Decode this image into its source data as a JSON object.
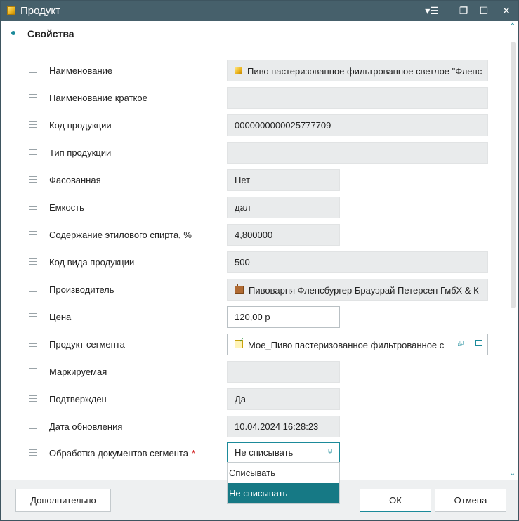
{
  "window": {
    "title": "Продукт",
    "controls": {
      "menu": "▾☰",
      "restore": "❐",
      "maximize": "☐",
      "close": "✕"
    }
  },
  "section": {
    "title": "Свойства"
  },
  "fields": [
    {
      "label": "Наименование",
      "value": "Пиво пастеризованное фильтрованное светлое \"Фленс",
      "icon": "product-icon"
    },
    {
      "label": "Наименование краткое",
      "value": ""
    },
    {
      "label": "Код продукции",
      "value": "0000000000025777709"
    },
    {
      "label": "Тип продукции",
      "value": ""
    },
    {
      "label": "Фасованная",
      "value": "Нет"
    },
    {
      "label": "Емкость",
      "value": "дал"
    },
    {
      "label": "Содержание этилового спирта, %",
      "value": "4,800000"
    },
    {
      "label": "Код вида продукции",
      "value": "500"
    },
    {
      "label": "Производитель",
      "value": "Пивоварня Фленсбургер Брауэрай Петерсен ГмбХ & К",
      "icon": "briefcase-icon"
    },
    {
      "label": "Цена",
      "value": "120,00 р"
    },
    {
      "label": "Продукт сегмента",
      "value": "Мое_Пиво пастеризованное фильтрованное с",
      "icon": "segment-product-icon"
    },
    {
      "label": "Маркируемая",
      "value": ""
    },
    {
      "label": "Подтвержден",
      "value": "Да"
    },
    {
      "label": "Дата обновления",
      "value": "10.04.2024 16:28:23"
    },
    {
      "label": "Обработка документов сегмента",
      "value": "Не списывать",
      "required": "*"
    }
  ],
  "dropdown": {
    "options": [
      "Списывать",
      "Не списывать"
    ],
    "selected": "Не списывать"
  },
  "footer": {
    "more_label": "Дополнительно",
    "ok_label": "ОК",
    "cancel_label": "Отмена"
  },
  "colors": {
    "accent": "#1b8a9a",
    "titlebar": "#46606b",
    "selected": "#167985"
  }
}
